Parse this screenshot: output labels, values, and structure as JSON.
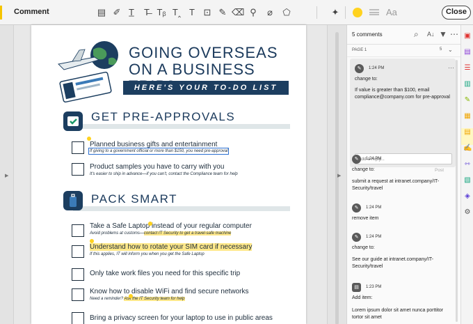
{
  "toolbar": {
    "title": "Comment",
    "close_label": "Close",
    "font_button": "Aa",
    "tools": [
      {
        "name": "sticky-note-icon",
        "glyph": "▤"
      },
      {
        "name": "highlight-pen-icon",
        "glyph": "✐"
      },
      {
        "name": "underline-text-icon",
        "glyph": "T̲"
      },
      {
        "name": "strikethrough-text-icon",
        "glyph": "T̶"
      },
      {
        "name": "replace-text-icon",
        "glyph": "Tᵦ"
      },
      {
        "name": "insert-text-icon",
        "glyph": "T‸"
      },
      {
        "name": "add-text-icon",
        "glyph": "T"
      },
      {
        "name": "text-box-icon",
        "glyph": "⊡"
      },
      {
        "name": "pencil-icon",
        "glyph": "✎"
      },
      {
        "name": "eraser-icon",
        "glyph": "⌫"
      },
      {
        "name": "stamp-icon",
        "glyph": "⚲"
      },
      {
        "name": "attach-icon",
        "glyph": "⌀"
      },
      {
        "name": "shapes-icon",
        "glyph": "⬠"
      },
      {
        "name": "pin-icon",
        "glyph": "✦"
      }
    ],
    "color": "#ffd21f"
  },
  "document": {
    "title_line1": "GOING OVERSEAS",
    "title_line2": "ON A BUSINESS TRIP?",
    "banner": "HERE'S YOUR TO-DO LIST",
    "section1": "GET PRE-APPROVALS",
    "section2": "PACK SMART",
    "items": [
      {
        "main": "Planned business gifts and entertainment",
        "sub": "If giving to a government official or more than $150, you need pre-approval"
      },
      {
        "main": "Product samples you have to carry with you",
        "sub": "It's easier to ship in advance—if you can't, contact the Compliance team for help"
      },
      {
        "main": "Take a Safe Laptop instead of your regular computer",
        "sub_a": "Avoid problems at customs—",
        "sub_b": "contact IT Security to get a travel-safe machine"
      },
      {
        "main": "Understand how to rotate your SIM card if necessary",
        "sub": "If this applies, IT will inform you when you get the Safe Laptop"
      },
      {
        "main": "Only take work files you need for this specific trip"
      },
      {
        "main": "Know how to disable WiFi and find secure networks",
        "sub_a": "Need a reminder? ",
        "sub_b": "Ask the IT Security team for help"
      },
      {
        "main": "Bring a privacy screen for your laptop to use in public areas"
      }
    ]
  },
  "comments_panel": {
    "count_label": "5 comments",
    "page_label": "PAGE 1",
    "page_count": "5",
    "reply_placeholder": "Add a reply...",
    "post_label": "Post",
    "comments": [
      {
        "time": "1:24 PM",
        "label": "change to:",
        "text": "If value is greater than $100, email compliance@company.com for pre-approval"
      },
      {
        "time": "1:24 PM",
        "label": "change to:",
        "text": "submit a request at intranet.company/IT-Security/travel"
      },
      {
        "time": "1:24 PM",
        "label": "remove item",
        "text": ""
      },
      {
        "time": "1:24 PM",
        "label": "change to:",
        "text": "See our guide at intranet.company/IT-Security/travel"
      },
      {
        "time": "1:23 PM",
        "label": "Add item:",
        "text": "Lorem ipsum dolor sit amet nunca porttitor tortor sit amet"
      }
    ]
  },
  "right_rail": [
    {
      "name": "export-pdf-icon",
      "color": "#e0312f"
    },
    {
      "name": "create-pdf-icon",
      "color": "#8b3fd6"
    },
    {
      "name": "organize-pages-icon",
      "color": "#e0312f"
    },
    {
      "name": "combine-files-icon",
      "color": "#16a57f"
    },
    {
      "name": "edit-pdf-icon",
      "color": "#86b700"
    },
    {
      "name": "scan-icon",
      "color": "#f0a500"
    },
    {
      "name": "comment-icon",
      "color": "#f0a500"
    },
    {
      "name": "fill-sign-icon",
      "color": "#8b3fd6"
    },
    {
      "name": "measure-icon",
      "color": "#5b3fd6"
    },
    {
      "name": "send-review-icon",
      "color": "#16a57f"
    },
    {
      "name": "protect-icon",
      "color": "#5b3fd6"
    },
    {
      "name": "more-tools-icon",
      "color": "#555555"
    }
  ]
}
